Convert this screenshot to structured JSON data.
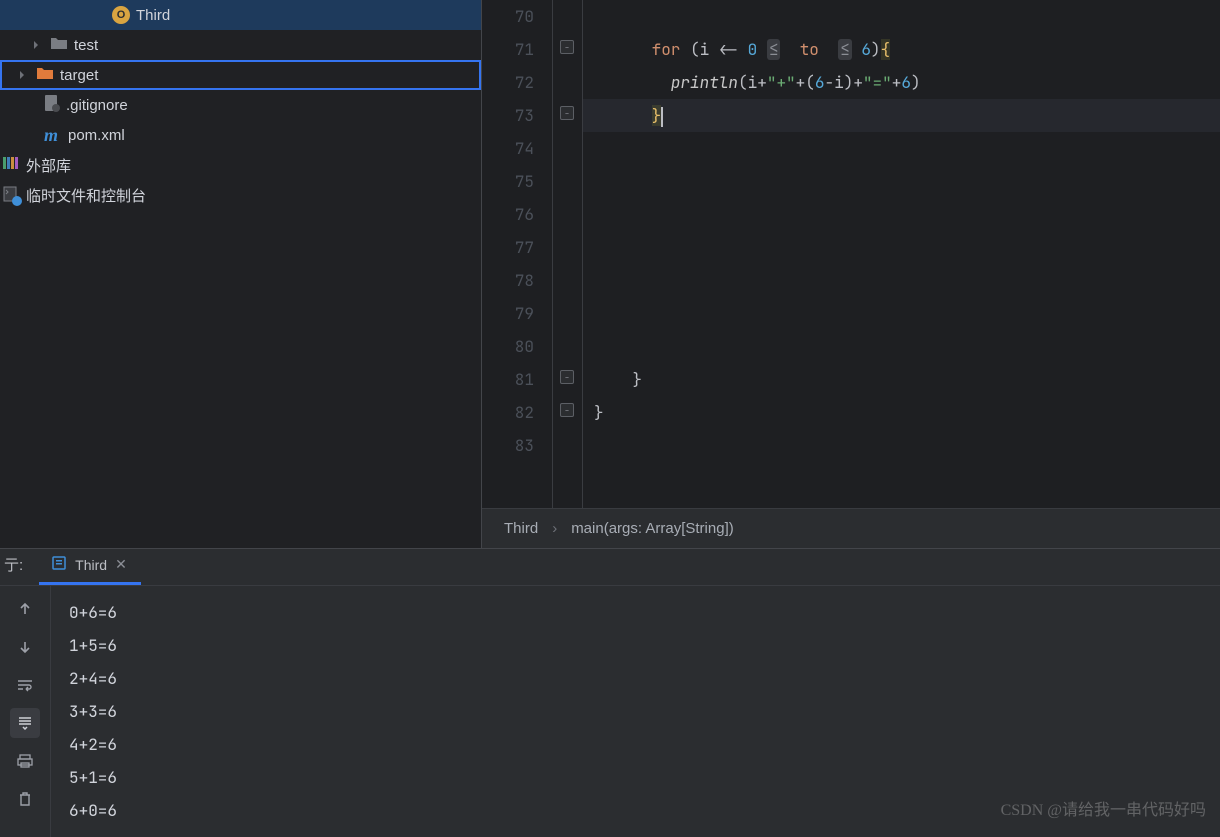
{
  "sidebar": {
    "items": [
      {
        "icon": "object-circle",
        "label": "Third",
        "indent": 3,
        "selected": true
      },
      {
        "icon": "folder-gray",
        "label": "test",
        "indent": 1,
        "arrow": "right"
      },
      {
        "icon": "folder-orange",
        "label": "target",
        "indent": 0,
        "arrow": "right",
        "current": true
      },
      {
        "icon": "gitignore",
        "label": ".gitignore",
        "indent": 1
      },
      {
        "icon": "maven-m",
        "label": "pom.xml",
        "indent": 1
      }
    ],
    "footer": [
      {
        "icon": "ext-lib",
        "label": "外部库"
      },
      {
        "icon": "scratch",
        "label": "临时文件和控制台"
      }
    ]
  },
  "editor": {
    "lines": [
      70,
      71,
      72,
      73,
      74,
      75,
      76,
      77,
      78,
      79,
      80,
      81,
      82,
      83
    ],
    "code": {
      "l71": {
        "kw": "for",
        "var": "i",
        "op1": "<-",
        "n0": "0",
        "hint_le1": "≤",
        "to_kw": "to",
        "hint_le2": "≤",
        "n6": "6",
        "brace_open": "{"
      },
      "l72": {
        "fn": "println",
        "open": "(",
        "var": "i",
        "plus": "+",
        "s1": "\"+\"",
        "paren_open": "(",
        "n6": "6",
        "minus": "-",
        "var2": "i",
        "paren_close": ")",
        "s2": "\"=\"",
        "close": ")",
        "tail_plus": "+",
        "tail_n": "6"
      },
      "l73": {
        "brace_close": "}"
      },
      "l81": {
        "brace": "}"
      },
      "l82": {
        "brace": "}"
      }
    },
    "breadcrumbs": [
      "Third",
      "main(args: Array[String])"
    ]
  },
  "run": {
    "tab_label": "Third",
    "left_label": "亍:",
    "output": [
      "0+6=6",
      "1+5=6",
      "2+4=6",
      "3+3=6",
      "4+2=6",
      "5+1=6",
      "6+0=6"
    ]
  },
  "watermark": "CSDN @请给我一串代码好吗"
}
